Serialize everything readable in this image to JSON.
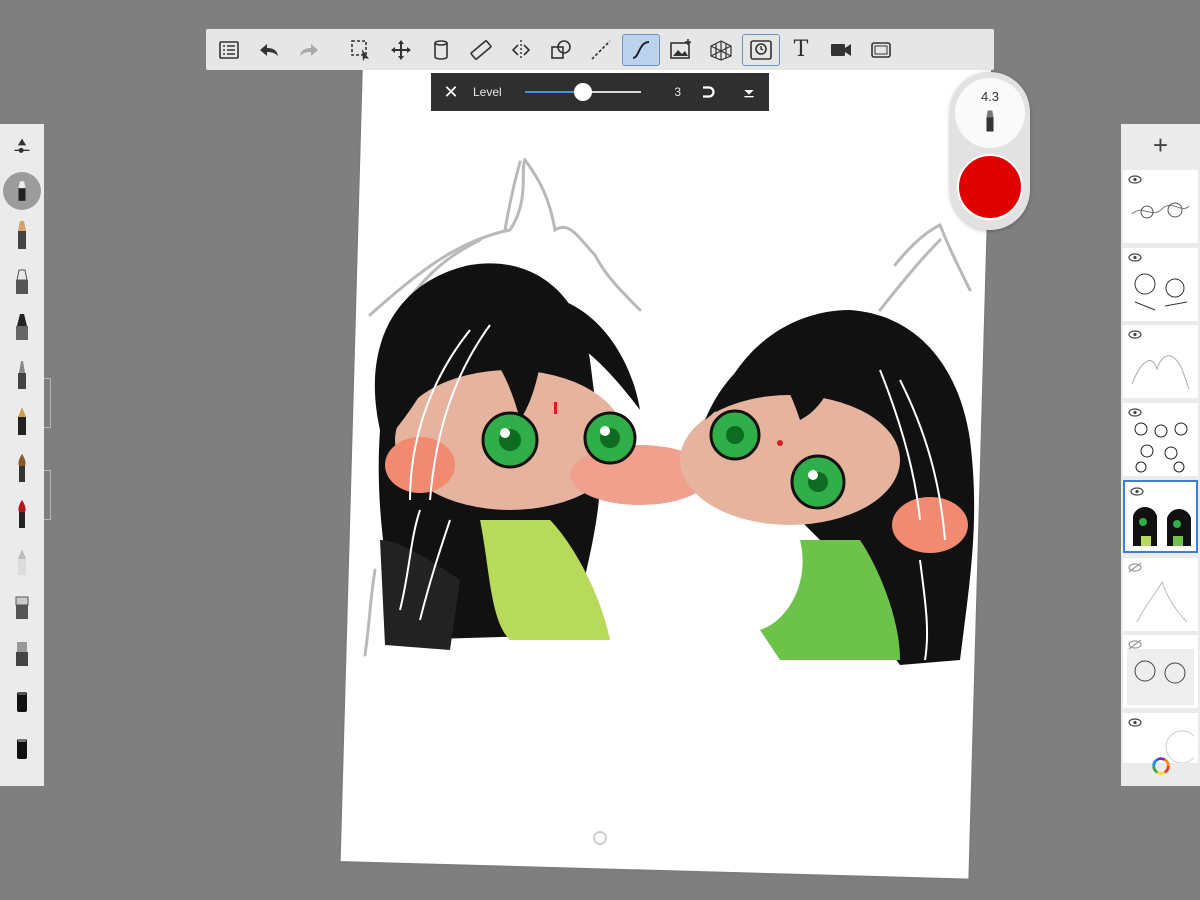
{
  "app": {
    "accent_color": "#4a90e2",
    "background_color": "#7f7f7f",
    "brush_color": "#e00000"
  },
  "top_toolbar": {
    "items": [
      {
        "icon": "list-icon",
        "active": false
      },
      {
        "icon": "undo-icon",
        "active": false
      },
      {
        "icon": "redo-icon",
        "active": false,
        "disabled": true
      },
      {
        "icon": "selection-icon",
        "active": false
      },
      {
        "icon": "transform-icon",
        "active": false
      },
      {
        "icon": "copic-icon",
        "active": false
      },
      {
        "icon": "ruler-icon",
        "active": false
      },
      {
        "icon": "symmetry-icon",
        "active": false
      },
      {
        "icon": "shapes-icon",
        "active": false
      },
      {
        "icon": "stroke-icon",
        "active": false
      },
      {
        "icon": "predictive-stroke-icon",
        "active": true
      },
      {
        "icon": "image-icon",
        "active": false
      },
      {
        "icon": "perspective-icon",
        "active": false
      },
      {
        "icon": "time-lapse-icon",
        "active": false,
        "outlined": true
      },
      {
        "icon": "text-icon",
        "label": "T",
        "active": false
      },
      {
        "icon": "video-icon",
        "active": false
      },
      {
        "icon": "fullscreen-icon",
        "active": false
      }
    ]
  },
  "level_bar": {
    "close_label": "✕",
    "label": "Level",
    "value": "3",
    "slider_fraction": 0.5
  },
  "brush_puck": {
    "size": "4.3",
    "color": "#e00000"
  },
  "left_brushes": [
    {
      "icon": "pencil-icon"
    },
    {
      "icon": "marker-icon"
    },
    {
      "icon": "pen-icon"
    },
    {
      "icon": "ballpoint-icon"
    },
    {
      "icon": "fountain-pen-icon"
    },
    {
      "icon": "paintbrush-icon"
    },
    {
      "icon": "ink-brush-icon"
    },
    {
      "icon": "airbrush-icon"
    },
    {
      "icon": "smudge-icon"
    },
    {
      "icon": "blender-icon"
    },
    {
      "icon": "eraser-icon"
    },
    {
      "icon": "soft-eraser-icon"
    }
  ],
  "layers": [
    {
      "visible": true,
      "selected": false
    },
    {
      "visible": true,
      "selected": false
    },
    {
      "visible": true,
      "selected": false
    },
    {
      "visible": true,
      "selected": false
    },
    {
      "visible": true,
      "selected": true
    },
    {
      "visible": false,
      "selected": false
    },
    {
      "visible": false,
      "selected": false
    },
    {
      "visible": true,
      "selected": false
    }
  ],
  "layer_bar": {
    "add_label": "+"
  }
}
